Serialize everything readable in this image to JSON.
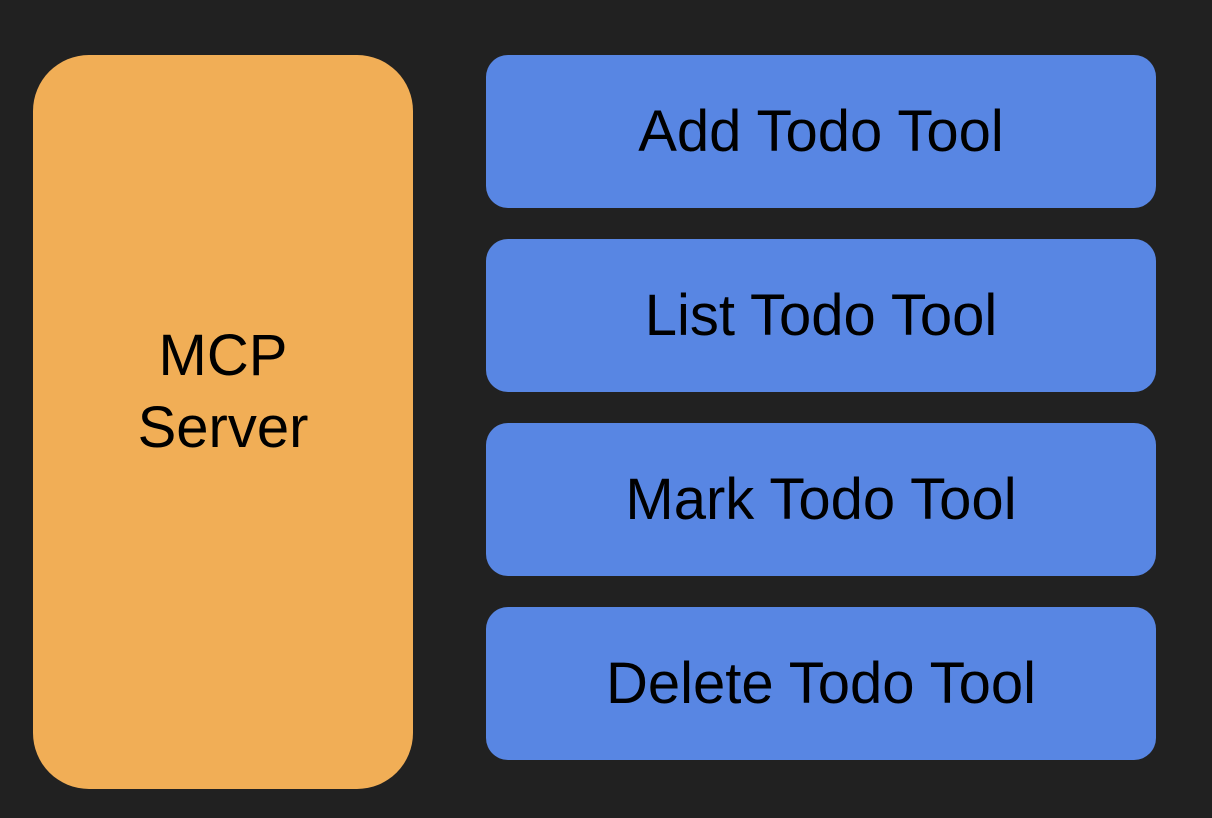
{
  "server": {
    "line1": "MCP",
    "line2": "Server"
  },
  "tools": [
    {
      "label": "Add Todo Tool"
    },
    {
      "label": "List Todo Tool"
    },
    {
      "label": "Mark Todo Tool"
    },
    {
      "label": "Delete Todo Tool"
    }
  ],
  "colors": {
    "background": "#212121",
    "server_fill": "#f1ae56",
    "tool_fill": "#5886e3",
    "text": "#000000"
  }
}
